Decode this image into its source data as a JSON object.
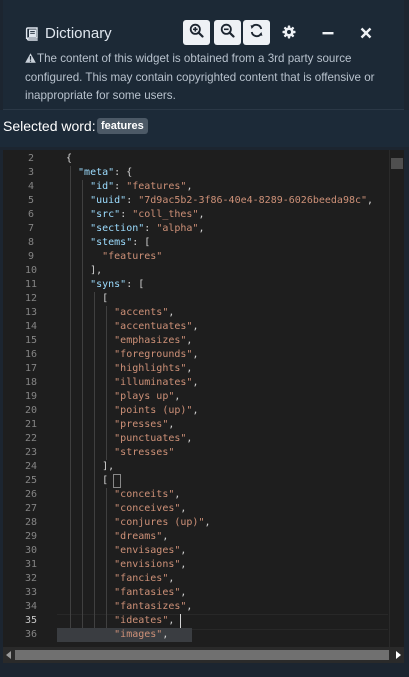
{
  "window": {
    "title": "Dictionary",
    "notice": "The content of this widget is obtained from a 3rd party source configured. This may contain copyrighted content that is offensive or inappropriate for some users."
  },
  "toolbar": {
    "icons": [
      "zoom-in-icon",
      "zoom-out-icon",
      "refresh-icon",
      "gear-icon",
      "minimize-icon",
      "close-icon"
    ]
  },
  "selected": {
    "label": "Selected word:",
    "word": "features"
  },
  "editor": {
    "active_line": 35,
    "lines": [
      {
        "n": "2",
        "t": [
          [
            "p",
            "{"
          ]
        ]
      },
      {
        "n": "3",
        "t": [
          [
            "k",
            "\"meta\""
          ],
          [
            "p",
            ": {"
          ]
        ]
      },
      {
        "n": "4",
        "t": [
          [
            "k",
            "\"id\""
          ],
          [
            "p",
            ": "
          ],
          [
            "s",
            "\"features\""
          ],
          [
            "p",
            ","
          ]
        ]
      },
      {
        "n": "5",
        "t": [
          [
            "k",
            "\"uuid\""
          ],
          [
            "p",
            ": "
          ],
          [
            "s",
            "\"7d9ac5b2-3f86-40e4-8289-6026beeda98c\""
          ],
          [
            "p",
            ","
          ]
        ]
      },
      {
        "n": "6",
        "t": [
          [
            "k",
            "\"src\""
          ],
          [
            "p",
            ": "
          ],
          [
            "s",
            "\"coll_thes\""
          ],
          [
            "p",
            ","
          ]
        ]
      },
      {
        "n": "7",
        "t": [
          [
            "k",
            "\"section\""
          ],
          [
            "p",
            ": "
          ],
          [
            "s",
            "\"alpha\""
          ],
          [
            "p",
            ","
          ]
        ]
      },
      {
        "n": "8",
        "t": [
          [
            "k",
            "\"stems\""
          ],
          [
            "p",
            ": ["
          ]
        ]
      },
      {
        "n": "9",
        "t": [
          [
            "s",
            "\"features\""
          ]
        ]
      },
      {
        "n": "10",
        "t": [
          [
            "p",
            "],"
          ]
        ]
      },
      {
        "n": "11",
        "t": [
          [
            "k",
            "\"syns\""
          ],
          [
            "p",
            ": ["
          ]
        ]
      },
      {
        "n": "12",
        "t": [
          [
            "p",
            "["
          ]
        ]
      },
      {
        "n": "13",
        "t": [
          [
            "s",
            "\"accents\""
          ],
          [
            "p",
            ","
          ]
        ]
      },
      {
        "n": "14",
        "t": [
          [
            "s",
            "\"accentuates\""
          ],
          [
            "p",
            ","
          ]
        ]
      },
      {
        "n": "15",
        "t": [
          [
            "s",
            "\"emphasizes\""
          ],
          [
            "p",
            ","
          ]
        ]
      },
      {
        "n": "16",
        "t": [
          [
            "s",
            "\"foregrounds\""
          ],
          [
            "p",
            ","
          ]
        ]
      },
      {
        "n": "17",
        "t": [
          [
            "s",
            "\"highlights\""
          ],
          [
            "p",
            ","
          ]
        ]
      },
      {
        "n": "18",
        "t": [
          [
            "s",
            "\"illuminates\""
          ],
          [
            "p",
            ","
          ]
        ]
      },
      {
        "n": "19",
        "t": [
          [
            "s",
            "\"plays up\""
          ],
          [
            "p",
            ","
          ]
        ]
      },
      {
        "n": "20",
        "t": [
          [
            "s",
            "\"points (up)\""
          ],
          [
            "p",
            ","
          ]
        ]
      },
      {
        "n": "21",
        "t": [
          [
            "s",
            "\"presses\""
          ],
          [
            "p",
            ","
          ]
        ]
      },
      {
        "n": "22",
        "t": [
          [
            "s",
            "\"punctuates\""
          ],
          [
            "p",
            ","
          ]
        ]
      },
      {
        "n": "23",
        "t": [
          [
            "s",
            "\"stresses\""
          ]
        ]
      },
      {
        "n": "24",
        "t": [
          [
            "p",
            "],"
          ]
        ]
      },
      {
        "n": "25",
        "t": [
          [
            "p",
            "["
          ]
        ]
      },
      {
        "n": "26",
        "t": [
          [
            "s",
            "\"conceits\""
          ],
          [
            "p",
            ","
          ]
        ]
      },
      {
        "n": "27",
        "t": [
          [
            "s",
            "\"conceives\""
          ],
          [
            "p",
            ","
          ]
        ]
      },
      {
        "n": "28",
        "t": [
          [
            "s",
            "\"conjures (up)\""
          ],
          [
            "p",
            ","
          ]
        ]
      },
      {
        "n": "29",
        "t": [
          [
            "s",
            "\"dreams\""
          ],
          [
            "p",
            ","
          ]
        ]
      },
      {
        "n": "30",
        "t": [
          [
            "s",
            "\"envisages\""
          ],
          [
            "p",
            ","
          ]
        ]
      },
      {
        "n": "31",
        "t": [
          [
            "s",
            "\"envisions\""
          ],
          [
            "p",
            ","
          ]
        ]
      },
      {
        "n": "32",
        "t": [
          [
            "s",
            "\"fancies\""
          ],
          [
            "p",
            ","
          ]
        ]
      },
      {
        "n": "33",
        "t": [
          [
            "s",
            "\"fantasies\""
          ],
          [
            "p",
            ","
          ]
        ]
      },
      {
        "n": "34",
        "t": [
          [
            "s",
            "\"fantasizes\""
          ],
          [
            "p",
            ","
          ]
        ]
      },
      {
        "n": "35",
        "t": [
          [
            "s",
            "\"ideates\""
          ],
          [
            "p",
            ","
          ]
        ]
      },
      {
        "n": "36",
        "t": [
          [
            "s",
            "\"images\""
          ],
          [
            "p",
            ","
          ]
        ]
      }
    ]
  },
  "colors": {
    "header_bg": "#1c2936",
    "editor_bg": "#1e1e1e",
    "json_key": "#9cdcfe",
    "json_string": "#ce9178",
    "punctuation": "#d4d4d4",
    "line_number": "#858585",
    "badge_bg": "#4c5966"
  }
}
